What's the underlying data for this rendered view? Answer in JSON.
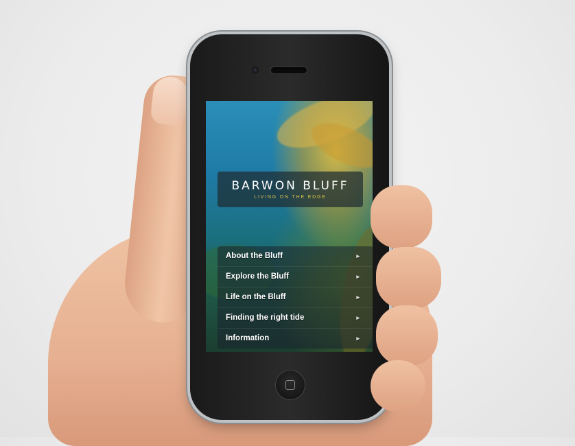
{
  "app": {
    "title": "BARWON BLUFF",
    "subtitle": "LIVING ON THE EDGE"
  },
  "menu": {
    "items": [
      {
        "label": "About the Bluff",
        "icon": "chevron-right-icon"
      },
      {
        "label": "Explore the Bluff",
        "icon": "chevron-right-icon"
      },
      {
        "label": "Life on the Bluff",
        "icon": "chevron-right-icon"
      },
      {
        "label": "Finding the right tide",
        "icon": "chevron-right-icon"
      },
      {
        "label": "Information",
        "icon": "chevron-right-icon"
      }
    ],
    "chevron_glyph": "▸"
  },
  "colors": {
    "accent": "#d8c24a",
    "menu_background": "#19232d",
    "water": "#2a8fb8"
  }
}
